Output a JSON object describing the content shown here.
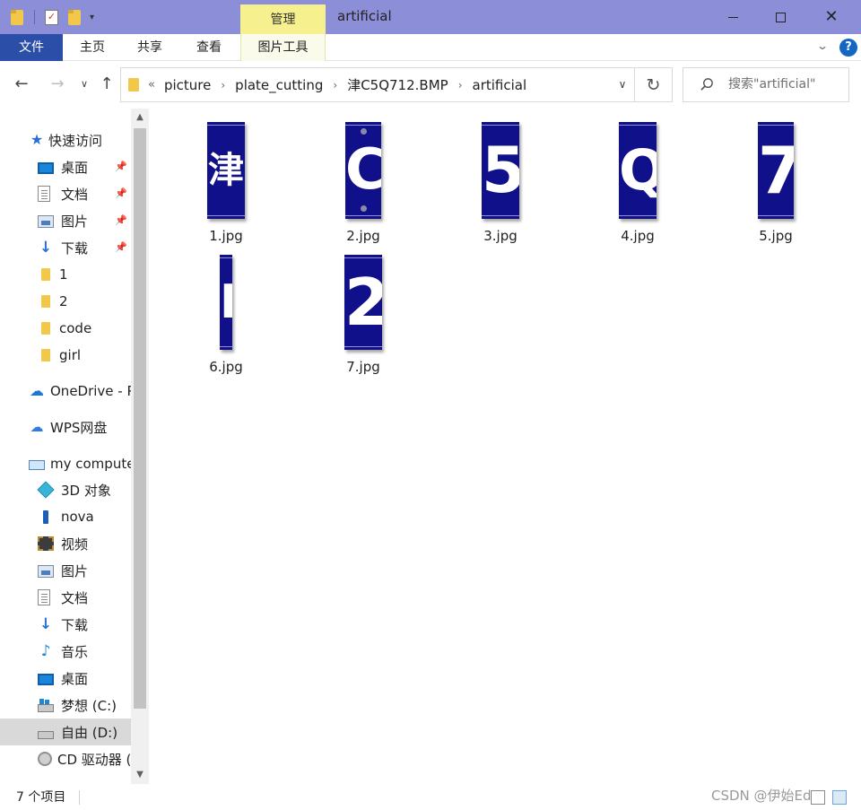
{
  "window": {
    "title": "artificial",
    "context_tab": "管理",
    "titlebar_color": "#8c8fd8"
  },
  "ribbon": {
    "file": "文件",
    "home": "主页",
    "share": "共享",
    "view": "查看",
    "picture_tools": "图片工具",
    "help": "?"
  },
  "address": {
    "overflow": "«",
    "crumbs": [
      "picture",
      "plate_cutting",
      "津C5Q712.BMP",
      "artificial"
    ]
  },
  "search": {
    "placeholder": "搜索\"artificial\""
  },
  "sidebar": {
    "quick_access": "快速访问",
    "pinned": [
      {
        "label": "桌面",
        "icon": "desktop-icon"
      },
      {
        "label": "文档",
        "icon": "document-icon"
      },
      {
        "label": "图片",
        "icon": "picture-icon"
      },
      {
        "label": "下载",
        "icon": "download-icon"
      }
    ],
    "folders": [
      "1",
      "2",
      "code",
      "girl"
    ],
    "onedrive": "OneDrive - P",
    "wps": "WPS网盘",
    "computer": "my compute",
    "computer_items": [
      {
        "label": "3D 对象",
        "icon": "3d-objects-icon"
      },
      {
        "label": "nova",
        "icon": "phone-icon"
      },
      {
        "label": "视频",
        "icon": "video-icon"
      },
      {
        "label": "图片",
        "icon": "picture-icon"
      },
      {
        "label": "文档",
        "icon": "document-icon"
      },
      {
        "label": "下载",
        "icon": "download-icon"
      },
      {
        "label": "音乐",
        "icon": "music-icon"
      },
      {
        "label": "桌面",
        "icon": "desktop-icon"
      },
      {
        "label": "梦想 (C:)",
        "icon": "windows-drive-icon"
      },
      {
        "label": "自由 (D:)",
        "icon": "drive-icon"
      },
      {
        "label": "CD 驱动器 (",
        "icon": "cd-drive-icon"
      }
    ],
    "selected": "自由 (D:)"
  },
  "files": [
    {
      "name": "1.jpg",
      "glyph": "津"
    },
    {
      "name": "2.jpg",
      "glyph": "C"
    },
    {
      "name": "3.jpg",
      "glyph": "5"
    },
    {
      "name": "4.jpg",
      "glyph": "Q"
    },
    {
      "name": "5.jpg",
      "glyph": "7"
    },
    {
      "name": "6.jpg",
      "glyph": "I"
    },
    {
      "name": "7.jpg",
      "glyph": "2"
    }
  ],
  "status": {
    "count": "7 个项目",
    "watermark": "CSDN @伊始Ed"
  },
  "colors": {
    "plate_blue": "#10108a",
    "file_tab": "#2b4fa8",
    "context_tab": "#f6f18e",
    "selected_row": "#d9d9d9"
  }
}
